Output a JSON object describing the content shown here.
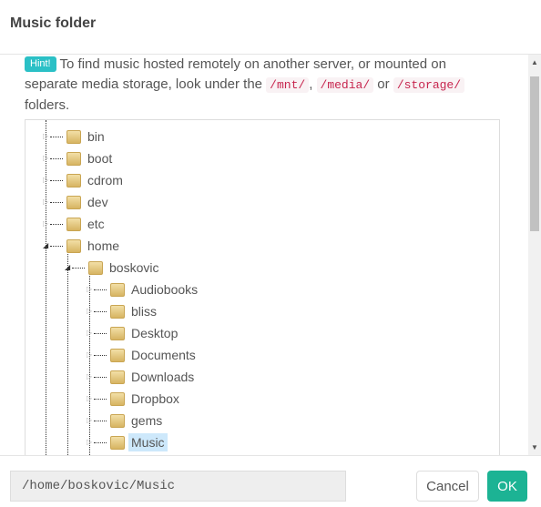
{
  "title": "Music folder",
  "hint": {
    "badge": "Hint!",
    "text1": "To find music hosted remotely on another server, or mounted on separate media storage, look under the ",
    "code1": "/mnt/",
    "sep1": ", ",
    "code2": "/media/",
    "sep2": " or ",
    "code3": "/storage/",
    "text2": " folders."
  },
  "tree": [
    {
      "label": "bin",
      "level": 0,
      "expanded": false
    },
    {
      "label": "boot",
      "level": 0,
      "expanded": false
    },
    {
      "label": "cdrom",
      "level": 0,
      "expanded": false
    },
    {
      "label": "dev",
      "level": 0,
      "expanded": false
    },
    {
      "label": "etc",
      "level": 0,
      "expanded": false
    },
    {
      "label": "home",
      "level": 0,
      "expanded": true
    },
    {
      "label": "boskovic",
      "level": 1,
      "expanded": true
    },
    {
      "label": "Audiobooks",
      "level": 2,
      "expanded": false
    },
    {
      "label": "bliss",
      "level": 2,
      "expanded": false
    },
    {
      "label": "Desktop",
      "level": 2,
      "expanded": false
    },
    {
      "label": "Documents",
      "level": 2,
      "expanded": false
    },
    {
      "label": "Downloads",
      "level": 2,
      "expanded": false
    },
    {
      "label": "Dropbox",
      "level": 2,
      "expanded": false
    },
    {
      "label": "gems",
      "level": 2,
      "expanded": false
    },
    {
      "label": "Music",
      "level": 2,
      "expanded": false,
      "selected": true
    }
  ],
  "footer": {
    "path": "/home/boskovic/Music",
    "cancel": "Cancel",
    "ok": "OK"
  },
  "colors": {
    "ok": "#1cb394",
    "hint": "#2bc0c6",
    "selection": "#cde8fb"
  }
}
